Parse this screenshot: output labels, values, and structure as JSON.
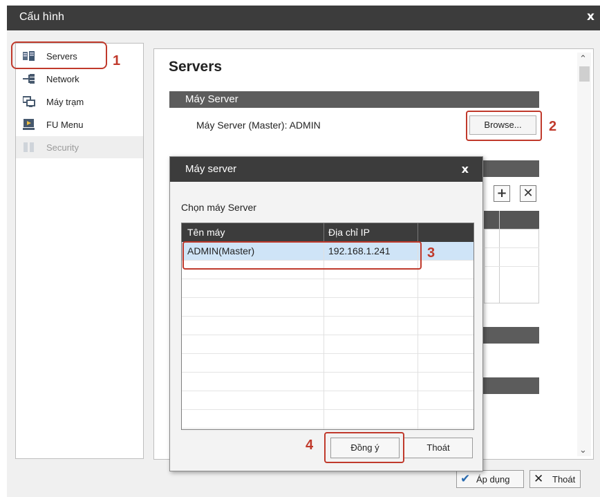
{
  "window": {
    "title": "Cấu hình",
    "close_glyph": "x"
  },
  "sidebar": {
    "items": [
      {
        "label": "Servers",
        "icon": "servers-icon",
        "state": "selected"
      },
      {
        "label": "Network",
        "icon": "network-icon",
        "state": "normal"
      },
      {
        "label": "Máy trạm",
        "icon": "workstation-icon",
        "state": "normal"
      },
      {
        "label": "FU Menu",
        "icon": "fu-menu-icon",
        "state": "normal"
      },
      {
        "label": "Security",
        "icon": "security-icon",
        "state": "disabled"
      }
    ]
  },
  "main": {
    "title": "Servers",
    "section_server": "Máy Server",
    "master_label": "Máy Server (Master): ADMIN",
    "browse_label": "Browse..."
  },
  "footer": {
    "apply_label": "Áp dụng",
    "exit_label": "Thoát"
  },
  "dialog": {
    "title": "Máy server",
    "close_glyph": "x",
    "prompt": "Chọn máy Server",
    "columns": [
      "Tên máy",
      "Địa chỉ IP"
    ],
    "rows": [
      {
        "name": "ADMIN(Master)",
        "ip": "192.168.1.241",
        "selected": true
      }
    ],
    "ok_label": "Đồng ý",
    "cancel_label": "Thoát"
  },
  "annotations": [
    "1",
    "2",
    "3",
    "4"
  ],
  "colors": {
    "title_bar": "#3c3c3c",
    "section_bar": "#5c5c5c",
    "annotation": "#c0392b",
    "selection": "#cfe4f7"
  }
}
